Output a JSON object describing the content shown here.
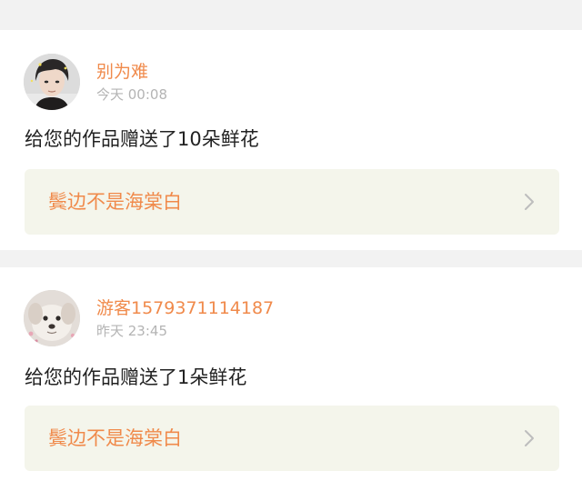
{
  "notifications": [
    {
      "username": "别为难",
      "timestamp": "今天 00:08",
      "message": "给您的作品赠送了10朵鲜花",
      "work_title": "鬓边不是海棠白",
      "avatar_icon": "user-avatar-icon"
    },
    {
      "username": "游客1579371114187",
      "timestamp": "昨天 23:45",
      "message": "给您的作品赠送了1朵鲜花",
      "work_title": "鬓边不是海棠白",
      "avatar_icon": "dog-avatar-icon"
    }
  ],
  "colors": {
    "accent": "#f08a4b",
    "timestamp": "#b4b4b4",
    "link_bg": "#f4f5eb",
    "page_bg": "#f2f2f2"
  }
}
